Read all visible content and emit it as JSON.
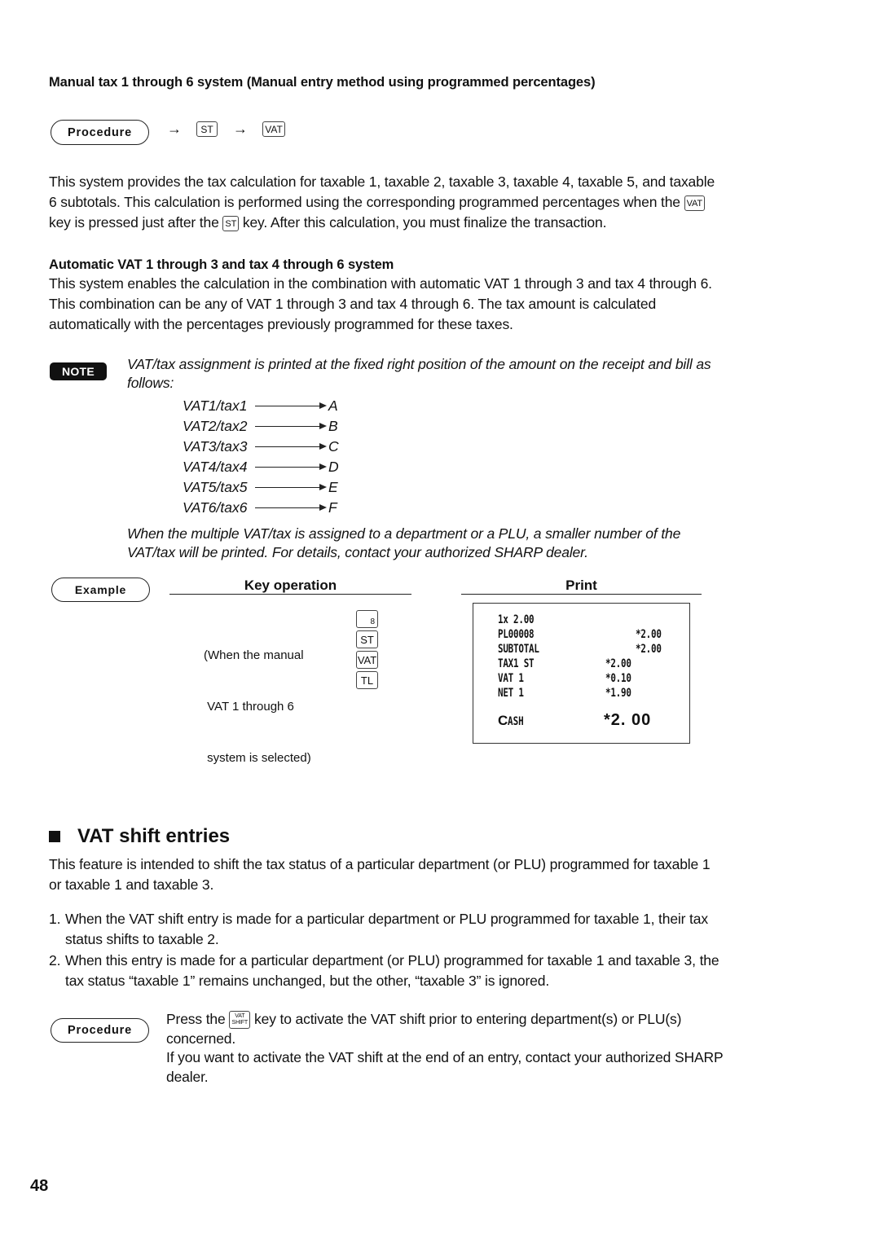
{
  "section1": {
    "heading": "Manual tax 1 through 6 system (Manual entry method using programmed percentages)",
    "procedure_label": "Procedure",
    "procedure_keys": [
      "ST",
      "VAT"
    ],
    "arrow_icon": "right-arrow",
    "para_line1": "This system provides the tax calculation for taxable 1, taxable 2, taxable 3, taxable 4, taxable 5, and taxable",
    "para_line2_pre": "6 subtotals. This calculation is performed using the corresponding programmed percentages when the",
    "para_line2_key": "VAT",
    "para_line3_pre": "key is pressed just after the",
    "para_line3_key": "ST",
    "para_line3_post": "key. After this calculation, you must finalize the transaction."
  },
  "section2": {
    "heading": "Automatic VAT 1 through 3 and tax 4 through 6 system",
    "para_lines": [
      "This system enables the calculation in the combination with automatic VAT 1 through 3 and tax 4 through 6.",
      "This combination can be any of VAT 1 through 3 and tax 4 through 6. The tax amount is calculated",
      "automatically with the percentages previously programmed for these taxes."
    ]
  },
  "note": {
    "badge": "NOTE",
    "line1": "VAT/tax assignment is printed at the fixed right position of the amount on the receipt and bill as",
    "line2": "follows:",
    "mapping": [
      {
        "from": "VAT1/tax1",
        "to": "A"
      },
      {
        "from": "VAT2/tax2",
        "to": "B"
      },
      {
        "from": "VAT3/tax3",
        "to": "C"
      },
      {
        "from": "VAT4/tax4",
        "to": "D"
      },
      {
        "from": "VAT5/tax5",
        "to": "E"
      },
      {
        "from": "VAT6/tax6",
        "to": "F"
      }
    ],
    "footer_line1": "When the multiple VAT/tax is assigned to a department or a PLU, a smaller number of the",
    "footer_line2": "VAT/tax will be printed. For details, contact your authorized SHARP dealer."
  },
  "example": {
    "label": "Example",
    "key_operation_header": "Key operation",
    "print_header": "Print",
    "condition_lines": [
      "(When the manual",
      " VAT 1 through 6",
      " system is selected)"
    ],
    "keys": [
      "8",
      "ST",
      "VAT",
      "TL"
    ],
    "receipt": {
      "lines": [
        {
          "label": "1x 2.00",
          "value": ""
        },
        {
          "label": "PL00008",
          "value": "*2.00"
        },
        {
          "label": "SUBTOTAL",
          "value": "*2.00"
        },
        {
          "label": "TAX1 ST",
          "value": "*2.00"
        },
        {
          "label": "VAT 1",
          "value": "*0.10"
        },
        {
          "label": "NET 1",
          "value": "*1.90"
        }
      ],
      "total_label_big": "C",
      "total_label_rest": "ASH",
      "total_value": "*2. 00"
    }
  },
  "vat_shift": {
    "title": "VAT shift entries",
    "intro_line1": "This feature is intended to shift the tax status of a particular department (or PLU) programmed for taxable 1",
    "intro_line2": "or taxable 1 and taxable 3.",
    "items": [
      {
        "num": "1.",
        "line1": "When the VAT shift entry is made for a particular department or PLU programmed for taxable 1, their tax",
        "line2": "status shifts to taxable 2."
      },
      {
        "num": "2.",
        "line1": "When this entry is made for a particular department (or PLU) programmed for taxable 1 and taxable 3, the",
        "line2": "tax status “taxable 1” remains unchanged, but the other, “taxable 3” is ignored."
      }
    ],
    "procedure_label": "Procedure",
    "proc_line1_pre": "Press the",
    "proc_key_top": "VAT",
    "proc_key_bottom": "SHIFT",
    "proc_line1_post": "key to activate the VAT shift prior to entering department(s) or PLU(s)",
    "proc_line2": "concerned.",
    "proc_line3": "If you want to activate the VAT shift at the end of an entry, contact your authorized SHARP",
    "proc_line4": "dealer."
  },
  "page_number": "48"
}
